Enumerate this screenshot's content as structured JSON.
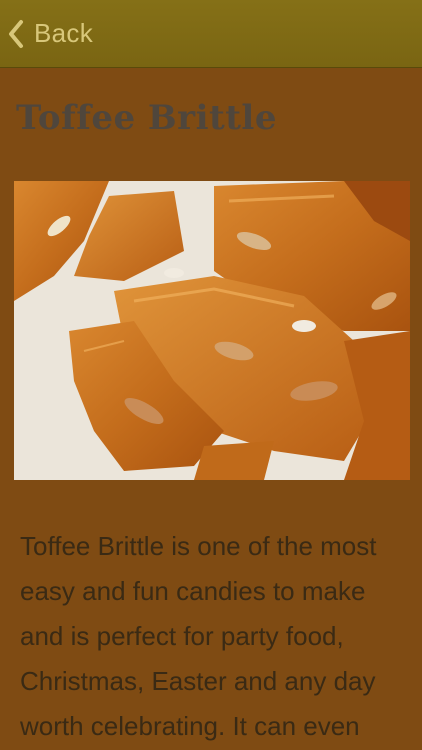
{
  "navbar": {
    "back_label": "Back",
    "icon": "chevron-left-icon",
    "color": "#857017"
  },
  "page": {
    "title": "Toffee Brittle",
    "image_alt": "toffee brittle pieces with almonds",
    "description": "Toffee Brittle is one of the most easy and fun candies to make and is perfect for party food, Christmas, Easter and any day worth celebrating. It can even"
  },
  "colors": {
    "background": "#7f4b13",
    "title": "#4f463c",
    "text": "#3a2a14",
    "accent": "#d8c77a"
  }
}
